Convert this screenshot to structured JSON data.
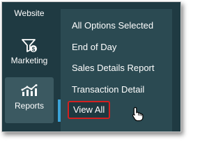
{
  "sidebar": {
    "items": [
      {
        "label": "Website",
        "icon": "website-icon"
      },
      {
        "label": "Marketing",
        "icon": "marketing-funnel-dollar-icon"
      },
      {
        "label": "Reports",
        "icon": "reports-chart-icon",
        "selected": true
      }
    ]
  },
  "submenu": {
    "items": [
      {
        "label": "All Options Selected"
      },
      {
        "label": "End of Day"
      },
      {
        "label": "Sales Details Report"
      },
      {
        "label": "Transaction Detail"
      },
      {
        "label": "View All",
        "highlighted": true
      }
    ]
  },
  "colors": {
    "sidebar_bg": "#1f3a42",
    "menu_bg": "#2b4a52",
    "selected_bg": "#3b5961",
    "active_bar": "#3aa3d8",
    "highlight_border": "#d42020"
  }
}
